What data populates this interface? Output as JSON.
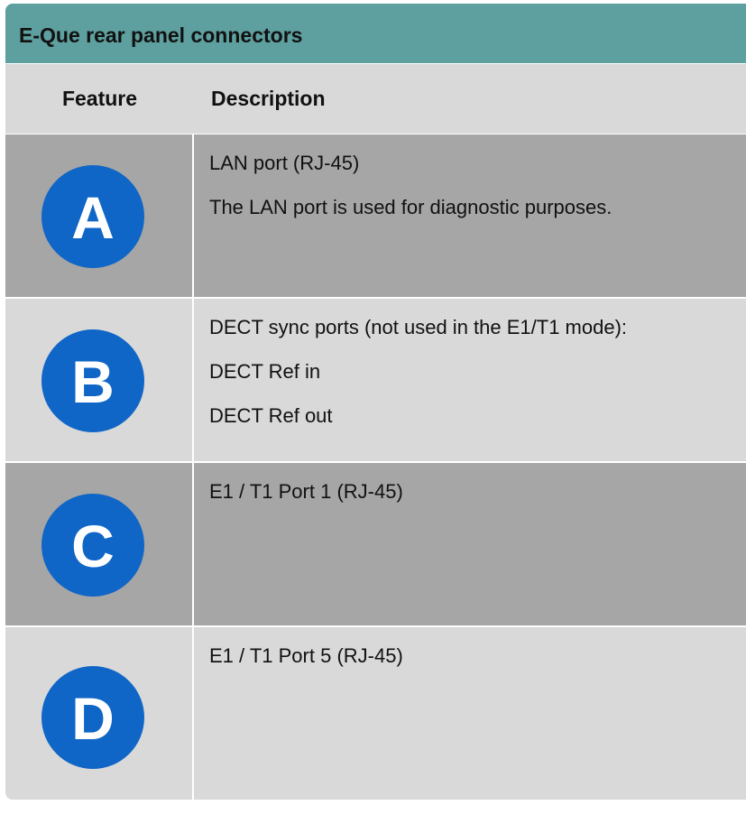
{
  "caption": "E-Que rear panel connectors",
  "columns": {
    "feature": "Feature",
    "description": "Description"
  },
  "rows": [
    {
      "letter": "A",
      "lines": [
        "LAN port (RJ-45)",
        "The LAN port is used for diagnostic purposes."
      ]
    },
    {
      "letter": "B",
      "lines": [
        "DECT sync ports (not used in the E1/T1 mode):",
        "DECT Ref in",
        "DECT Ref out"
      ]
    },
    {
      "letter": "C",
      "lines": [
        "E1 / T1 Port 1 (RJ-45)"
      ]
    },
    {
      "letter": "D",
      "lines": [
        "E1 / T1 Port 5 (RJ-45)"
      ]
    }
  ],
  "colors": {
    "caption_bg": "#5e9f9f",
    "row_dark": "#a6a6a6",
    "row_light": "#d9d9d9",
    "badge": "#1066c6"
  }
}
